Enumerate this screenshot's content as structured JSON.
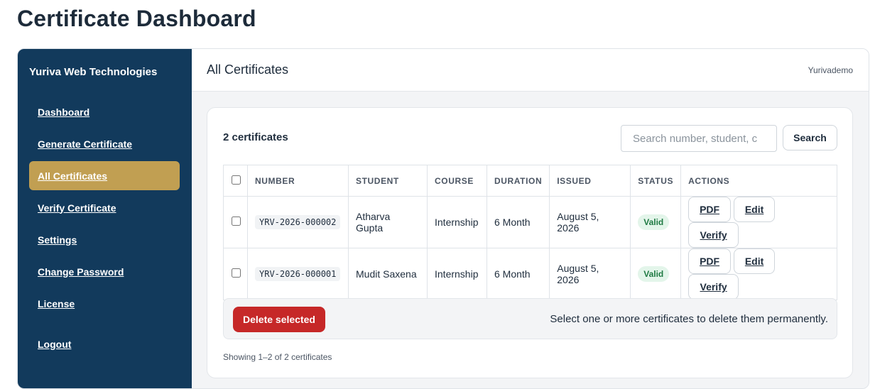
{
  "page_title": "Certificate Dashboard",
  "sidebar": {
    "brand": "Yuriva Web Technologies",
    "items": [
      {
        "label": "Dashboard"
      },
      {
        "label": "Generate Certificate"
      },
      {
        "label": "All Certificates",
        "active": true
      },
      {
        "label": "Verify Certificate"
      },
      {
        "label": "Settings"
      },
      {
        "label": "Change Password"
      },
      {
        "label": "License"
      },
      {
        "label": "Logout"
      }
    ]
  },
  "header": {
    "title": "All Certificates",
    "user": "Yurivademo"
  },
  "toolbar": {
    "count_label": "2 certificates",
    "search_placeholder": "Search number, student, c",
    "search_value": "",
    "search_button": "Search"
  },
  "table": {
    "columns": [
      "NUMBER",
      "STUDENT",
      "COURSE",
      "DURATION",
      "ISSUED",
      "STATUS",
      "ACTIONS"
    ],
    "rows": [
      {
        "number": "YRV-2026-000002",
        "student": "Atharva Gupta",
        "course": "Internship",
        "duration": "6 Month",
        "issued": "August 5, 2026",
        "status": "Valid",
        "checked": false
      },
      {
        "number": "YRV-2026-000001",
        "student": "Mudit Saxena",
        "course": "Internship",
        "duration": "6 Month",
        "issued": "August 5, 2026",
        "status": "Valid",
        "checked": false
      }
    ],
    "actions": {
      "pdf": "PDF",
      "edit": "Edit",
      "verify": "Verify"
    }
  },
  "bulk": {
    "delete_label": "Delete selected",
    "hint": "Select one or more certificates to delete them permanently."
  },
  "pagination": "Showing 1–2 of 2 certificates",
  "colors": {
    "sidebar_bg": "#123a5c",
    "active_item": "#c19f52",
    "danger": "#c62828",
    "valid_badge_bg": "#e3f5ea",
    "valid_badge_text": "#1f7a43"
  }
}
